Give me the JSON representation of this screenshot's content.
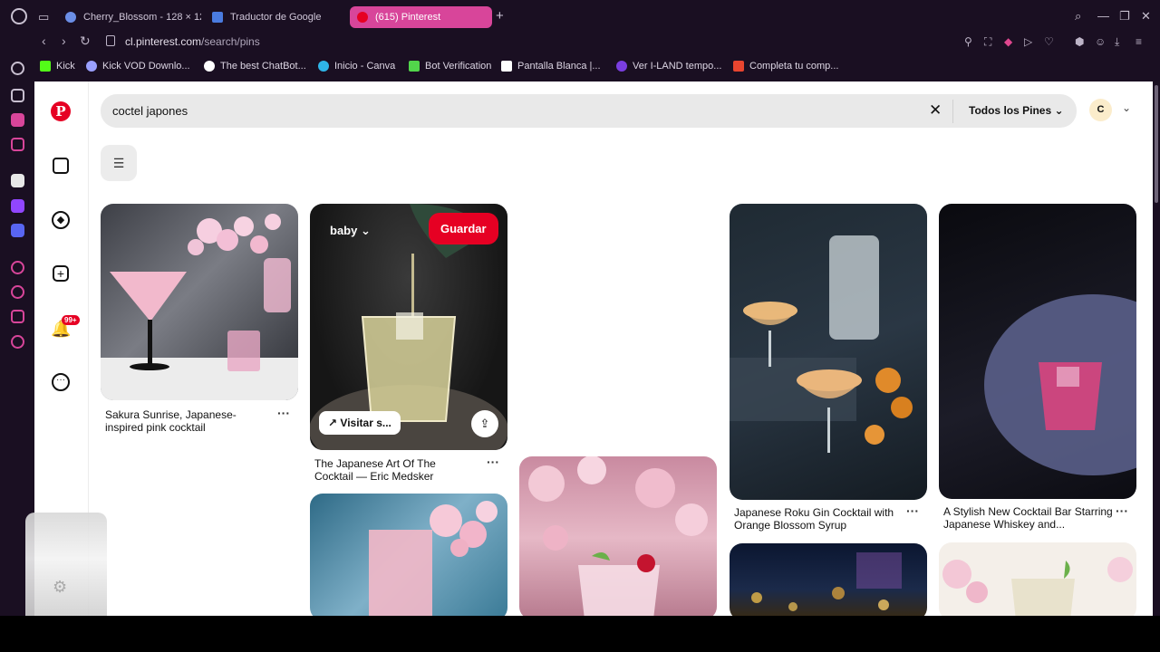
{
  "browser": {
    "tabs": [
      {
        "label": "Cherry_Blossom - 128 × 12",
        "color": "#6b8ee6"
      },
      {
        "label": "Traductor de Google",
        "color": "#4a7be0"
      },
      {
        "label": "(615) Pinterest",
        "color": "#e60023"
      }
    ],
    "url_domain": "cl.pinterest.com",
    "url_path": "/search/pins",
    "bookmarks": [
      {
        "label": "Kick",
        "color": "#53fc18"
      },
      {
        "label": "Kick VOD Downlo...",
        "color": "#9aa0ff"
      },
      {
        "label": "The best ChatBot...",
        "color": "#ffffff"
      },
      {
        "label": "Inicio - Canva",
        "color": "#2fb5e8"
      },
      {
        "label": "Bot Verification",
        "color": "#52d64b"
      },
      {
        "label": "Pantalla Blanca |...",
        "color": "#ffffff"
      },
      {
        "label": "Ver I-LAND tempo...",
        "color": "#7a3ee0"
      },
      {
        "label": "Completa tu comp...",
        "color": "#e8452f"
      }
    ]
  },
  "pinterest": {
    "search_query": "coctel japones",
    "scope_label": "Todos los Pines",
    "avatar_initial": "C",
    "notif_badge": "99+",
    "pins": [
      {
        "caption": "Sakura Sunrise, Japanese-inspired pink cocktail"
      },
      {
        "caption": "The Japanese Art Of The Cocktail — Eric Medsker",
        "board": "baby",
        "save": "Guardar",
        "visit": "Visitar s..."
      },
      {
        "caption": "Japanese Roku Gin Cocktail with Orange Blossom Syrup"
      },
      {
        "caption": "A Stylish New Cocktail Bar Starring Japanese Whiskey and..."
      }
    ]
  },
  "colors": {
    "brand": "#e60023",
    "chrome": "#1a0f22",
    "active_tab": "#d8459a"
  }
}
